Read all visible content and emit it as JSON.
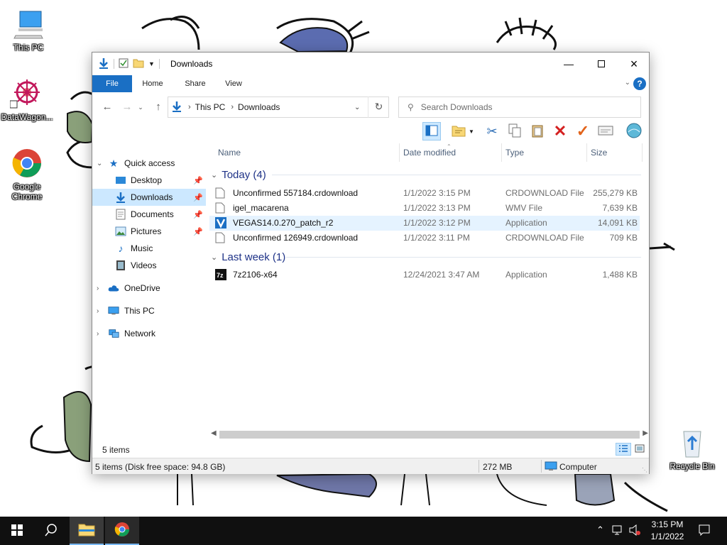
{
  "desktop": {
    "icons": [
      {
        "label": "This PC",
        "icon": "this-pc-icon"
      },
      {
        "label": "DataWagon...",
        "icon": "datawagon-shortcut-icon"
      },
      {
        "label": "Google Chrome",
        "icon": "chrome-shortcut-icon"
      },
      {
        "label": "Recycle Bin",
        "icon": "recycle-bin-icon"
      }
    ]
  },
  "window": {
    "title": "Downloads",
    "ribbon_tabs": {
      "file": "File",
      "home": "Home",
      "share": "Share",
      "view": "View"
    },
    "address": {
      "root": "This PC",
      "current": "Downloads"
    },
    "search": {
      "placeholder": "Search Downloads"
    },
    "nav": {
      "quick_access": "Quick access",
      "desktop": "Desktop",
      "downloads": "Downloads",
      "documents": "Documents",
      "pictures": "Pictures",
      "music": "Music",
      "videos": "Videos",
      "onedrive": "OneDrive",
      "this_pc": "This PC",
      "network": "Network"
    },
    "columns": {
      "name": "Name",
      "date": "Date modified",
      "type": "Type",
      "size": "Size"
    },
    "groups": {
      "today": {
        "label": "Today (4)",
        "files": [
          {
            "name": "Unconfirmed 557184.crdownload",
            "date": "1/1/2022 3:15 PM",
            "type": "CRDOWNLOAD File",
            "size": "255,279 KB"
          },
          {
            "name": "igel_macarena",
            "date": "1/1/2022 3:13 PM",
            "type": "WMV File",
            "size": "7,639 KB"
          },
          {
            "name": "VEGAS14.0.270_patch_r2",
            "date": "1/1/2022 3:12 PM",
            "type": "Application",
            "size": "14,091 KB"
          },
          {
            "name": "Unconfirmed 126949.crdownload",
            "date": "1/1/2022 3:11 PM",
            "type": "CRDOWNLOAD File",
            "size": "709 KB"
          }
        ]
      },
      "last_week": {
        "label": "Last week (1)",
        "files": [
          {
            "name": "7z2106-x64",
            "date": "12/24/2021 3:47 AM",
            "type": "Application",
            "size": "1,488 KB"
          }
        ]
      }
    },
    "status": {
      "item_count": "5 items",
      "disk_info": "5 items (Disk free space: 94.8 GB)",
      "size": "272 MB",
      "location": "Computer"
    }
  },
  "taskbar": {
    "clock_time": "3:15 PM",
    "clock_date": "1/1/2022"
  },
  "colors": {
    "accent": "#1a6fc4",
    "selection": "#cce8ff",
    "hover_row": "#e5f3ff",
    "taskbar": "#101010"
  }
}
